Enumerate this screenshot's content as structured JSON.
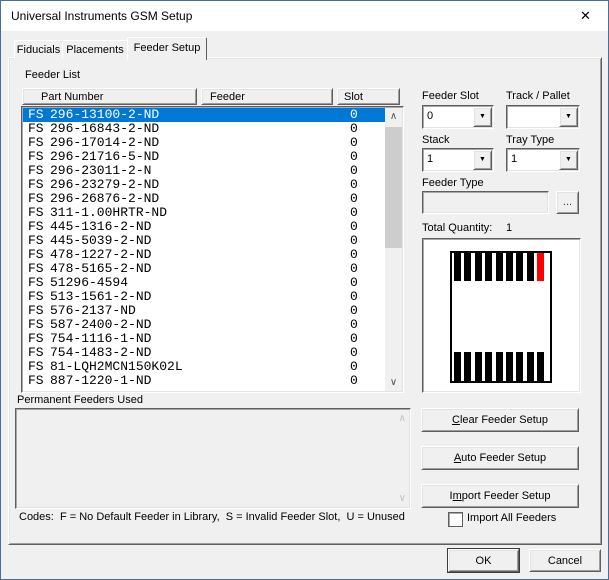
{
  "window": {
    "title": "Universal Instruments GSM Setup",
    "close_icon": "✕"
  },
  "tabs": [
    {
      "label": "Fiducials"
    },
    {
      "label": "Placements"
    },
    {
      "label": "Feeder Setup"
    }
  ],
  "feeder_list": {
    "label": "Feeder List",
    "columns": [
      "Part Number",
      "Feeder",
      "Slot"
    ],
    "rows": [
      {
        "code": "FS",
        "part": "296-13100-2-ND",
        "feeder": "",
        "slot": "0",
        "selected": true
      },
      {
        "code": "FS",
        "part": "296-16843-2-ND",
        "feeder": "",
        "slot": "0",
        "selected": false
      },
      {
        "code": "FS",
        "part": "296-17014-2-ND",
        "feeder": "",
        "slot": "0",
        "selected": false
      },
      {
        "code": "FS",
        "part": "296-21716-5-ND",
        "feeder": "",
        "slot": "0",
        "selected": false
      },
      {
        "code": "FS",
        "part": "296-23011-2-N",
        "feeder": "",
        "slot": "0",
        "selected": false
      },
      {
        "code": "FS",
        "part": "296-23279-2-ND",
        "feeder": "",
        "slot": "0",
        "selected": false
      },
      {
        "code": "FS",
        "part": "296-26876-2-ND",
        "feeder": "",
        "slot": "0",
        "selected": false
      },
      {
        "code": "FS",
        "part": "311-1.00HRTR-ND",
        "feeder": "",
        "slot": "0",
        "selected": false
      },
      {
        "code": "FS",
        "part": "445-1316-2-ND",
        "feeder": "",
        "slot": "0",
        "selected": false
      },
      {
        "code": "FS",
        "part": "445-5039-2-ND",
        "feeder": "",
        "slot": "0",
        "selected": false
      },
      {
        "code": "FS",
        "part": "478-1227-2-ND",
        "feeder": "",
        "slot": "0",
        "selected": false
      },
      {
        "code": "FS",
        "part": "478-5165-2-ND",
        "feeder": "",
        "slot": "0",
        "selected": false
      },
      {
        "code": "FS",
        "part": "51296-4594",
        "feeder": "",
        "slot": "0",
        "selected": false
      },
      {
        "code": "FS",
        "part": "513-1561-2-ND",
        "feeder": "",
        "slot": "0",
        "selected": false
      },
      {
        "code": "FS",
        "part": "576-2137-ND",
        "feeder": "",
        "slot": "0",
        "selected": false
      },
      {
        "code": "FS",
        "part": "587-2400-2-ND",
        "feeder": "",
        "slot": "0",
        "selected": false
      },
      {
        "code": "FS",
        "part": "754-1116-1-ND",
        "feeder": "",
        "slot": "0",
        "selected": false
      },
      {
        "code": "FS",
        "part": "754-1483-2-ND",
        "feeder": "",
        "slot": "0",
        "selected": false
      },
      {
        "code": "FS",
        "part": "81-LQH2MCN150K02L",
        "feeder": "",
        "slot": "0",
        "selected": false
      },
      {
        "code": "FS",
        "part": "887-1220-1-ND",
        "feeder": "",
        "slot": "0",
        "selected": false
      }
    ]
  },
  "right_panel": {
    "feeder_slot": {
      "label": "Feeder Slot",
      "value": "0"
    },
    "track_pallet": {
      "label": "Track / Pallet",
      "value": ""
    },
    "stack": {
      "label": "Stack",
      "value": "1"
    },
    "tray_type": {
      "label": "Tray Type",
      "value": "1"
    },
    "feeder_type": {
      "label": "Feeder Type",
      "value": "",
      "browse": "..."
    },
    "total_quantity_label": "Total Quantity:",
    "total_quantity_value": "1",
    "machine_view": {
      "top_slots": [
        "#000000",
        "#000000",
        "#000000",
        "#000000",
        "#000000",
        "#000000",
        "#000000",
        "#000000",
        "#ff0000"
      ],
      "bottom_slots": [
        "#000000",
        "#000000",
        "#000000",
        "#000000",
        "#000000",
        "#000000",
        "#000000",
        "#000000",
        "#000000"
      ]
    }
  },
  "permanent_feeders": {
    "label": "Permanent Feeders Used"
  },
  "codes_line": "Codes:  F = No Default Feeder in Library,  S = Invalid Feeder Slot,  U = Unused",
  "buttons": {
    "clear": {
      "pre": "",
      "accel": "C",
      "rest": "lear Feeder Setup"
    },
    "auto": {
      "pre": "",
      "accel": "A",
      "rest": "uto Feeder Setup"
    },
    "import": {
      "pre": "I",
      "accel": "m",
      "rest": "port Feeder Setup"
    },
    "ok": "OK",
    "cancel": "Cancel"
  },
  "import_all": {
    "label": "Import All Feeders",
    "checked": false
  },
  "colors": {
    "selection": "#0078d7",
    "slot_highlight": "#ff0000",
    "slot_normal": "#000000"
  }
}
